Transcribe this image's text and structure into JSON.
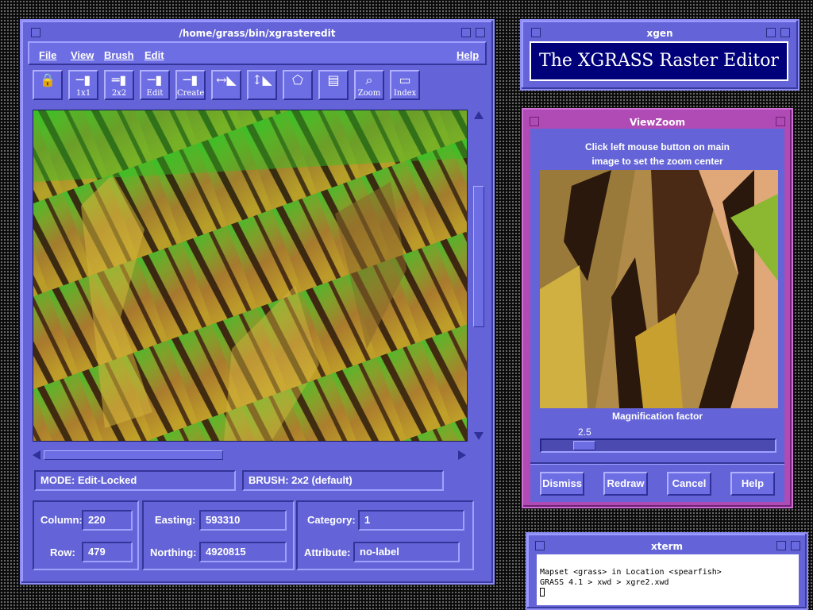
{
  "editor": {
    "title": "/home/grass/bin/xgrasteredit",
    "menus": [
      "File",
      "View",
      "Brush",
      "Edit"
    ],
    "menu_help": "Help",
    "tools": [
      {
        "caption": "",
        "icon": "lock-icon"
      },
      {
        "caption": "1x1",
        "icon": "brush-1x1-icon"
      },
      {
        "caption": "2x2",
        "icon": "brush-2x2-icon"
      },
      {
        "caption": "Edit",
        "icon": "edit-brush-icon"
      },
      {
        "caption": "Create",
        "icon": "create-brush-icon"
      },
      {
        "caption": "",
        "icon": "horizontal-move-icon"
      },
      {
        "caption": "",
        "icon": "vertical-move-icon"
      },
      {
        "caption": "",
        "icon": "polygon-select-icon"
      },
      {
        "caption": "",
        "icon": "box-select-icon"
      },
      {
        "caption": "Zoom",
        "icon": "zoom-icon"
      },
      {
        "caption": "Index",
        "icon": "index-icon"
      }
    ],
    "mode": "MODE: Edit-Locked",
    "brush": "BRUSH: 2x2 (default)",
    "column_label": "Column:",
    "column_value": "220",
    "row_label": "Row:",
    "row_value": "479",
    "easting_label": "Easting:",
    "easting_value": "593310",
    "northing_label": "Northing:",
    "northing_value": "4920815",
    "category_label": "Category:",
    "category_value": "1",
    "attribute_label": "Attribute:",
    "attribute_value": "no-label"
  },
  "xgen": {
    "title": "xgen",
    "banner": "The XGRASS Raster Editor"
  },
  "viewzoom": {
    "title": "ViewZoom",
    "instruction_line1": "Click left mouse button on main",
    "instruction_line2": "image to set the zoom center",
    "magnification_label": "Magnification factor",
    "magnification_value": "2.5",
    "magnification_fraction": 0.15,
    "buttons": {
      "dismiss": "Dismiss",
      "redraw": "Redraw",
      "cancel": "Cancel",
      "help": "Help"
    }
  },
  "xterm": {
    "title": "xterm",
    "line1": "Mapset <grass> in Location <spearfish>",
    "line2": "GRASS 4.1 > xwd > xgre2.xwd"
  },
  "colors": {
    "window": "#6464d8",
    "viewzoom_frame": "#b04ab4",
    "xgen_banner": "#00007a"
  }
}
